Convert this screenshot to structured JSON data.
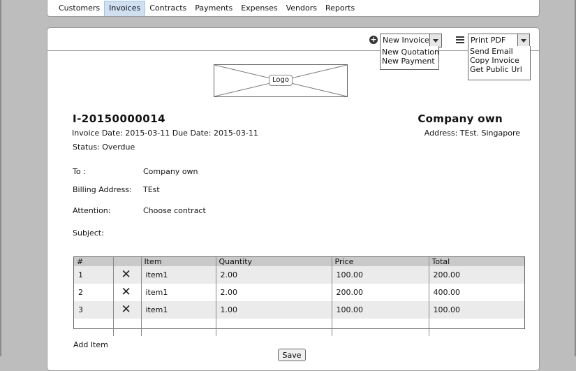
{
  "nav": {
    "items": [
      {
        "label": "Customers"
      },
      {
        "label": "Invoices",
        "active": true
      },
      {
        "label": "Contracts"
      },
      {
        "label": "Payments"
      },
      {
        "label": "Expenses"
      },
      {
        "label": "Vendors"
      },
      {
        "label": "Reports"
      }
    ]
  },
  "toolbar": {
    "new_invoice_label": "New Invoice",
    "new_menu": [
      "New Quotation",
      "New Payment"
    ],
    "print_pdf_label": "Print PDF",
    "print_menu": [
      "Send Email",
      "Copy Invoice",
      "Get Public Url"
    ]
  },
  "logo": {
    "label": "Logo"
  },
  "invoice": {
    "number": "I-20150000014",
    "dates": "Invoice Date: 2015-03-11 Due Date: 2015-03-11",
    "status": "Status: Overdue"
  },
  "company": {
    "name": "Company own",
    "address": "Address: TEst. Singapore"
  },
  "fields": {
    "to_label": "To :",
    "to_value": "Company own",
    "billing_label": "Billing Address:",
    "billing_value": "TEst",
    "attention_label": "Attention:",
    "attention_value": "Choose contract",
    "subject_label": "Subject:"
  },
  "table": {
    "headers": [
      "#",
      "",
      "Item",
      "Quantity",
      "Price",
      "Total"
    ],
    "rows": [
      {
        "num": "1",
        "item": "item1",
        "quantity": "2.00",
        "price": "100.00",
        "total": "200.00"
      },
      {
        "num": "2",
        "item": "item1",
        "quantity": "2.00",
        "price": "200.00",
        "total": "400.00"
      },
      {
        "num": "3",
        "item": "item1",
        "quantity": "1.00",
        "price": "100.00",
        "total": "100.00"
      }
    ]
  },
  "actions": {
    "add_item_label": "Add Item",
    "save_label": "Save"
  },
  "icons": {
    "plus": "plus-circle-icon",
    "menu": "hamburger-icon",
    "delete": "x-icon"
  }
}
